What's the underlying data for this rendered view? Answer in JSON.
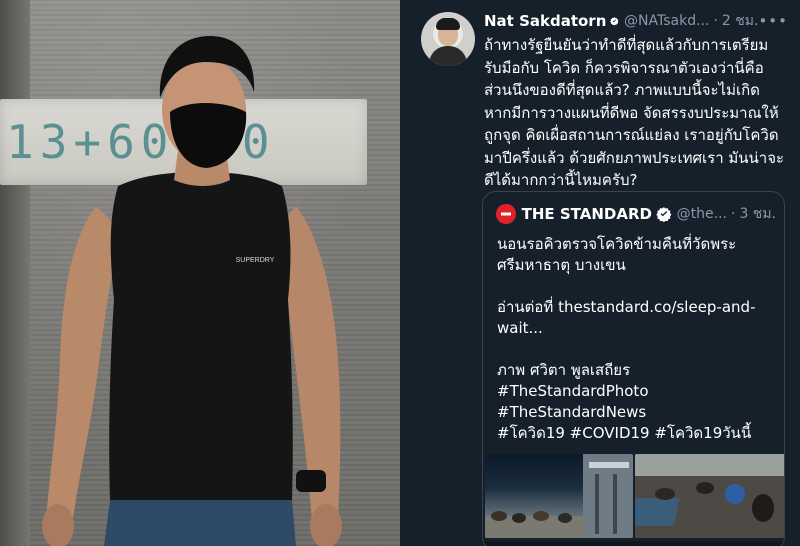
{
  "photo": {
    "sign_text": "13+60  00",
    "shirt_brand": "SUPERDRY"
  },
  "tweet": {
    "display_name": "Nat Sakdatorn",
    "handle": "@NATsakd...",
    "separator": "·",
    "time": "2 ชม.",
    "more_label": "•••",
    "body": "ถ้าทางรัฐยืนยันว่าทำดีที่สุดแล้วกับการเตรียม\nรับมือกับ โควิด ก็ควรพิจารณาตัวเองว่านี่คือ\nส่วนนึงของดีที่สุดแล้ว? ภาพแบบนี้จะไม่เกิด\nหากมีการวางแผนที่ดีพอ จัดสรรงบประมาณให้\nถูกจุด คิดเผื่อสถานการณ์แย่ลง เราอยู่กับโควิด\nมาปีครึ่งแล้ว ด้วยศักยภาพประเทศเรา มันน่าจะ\nดีได้มากกว่านี้ไหมครับ?",
    "quote": {
      "logo_text": "THE STANDARD",
      "display_name": "THE STANDARD",
      "handle": "@the...",
      "separator": "·",
      "time": "3 ชม.",
      "lines": [
        "นอนรอคิวตรวจโควิดข้ามคืนที่วัดพระ",
        "ศรีมหาธาตุ บางเขน",
        "อ่านต่อที่ thestandard.co/sleep-and-",
        "wait...",
        "ภาพ ศวิตา พูลเสถียร",
        "#TheStandardPhoto",
        "#TheStandardNews",
        "#โควิด19 #COVID19 #โควิด19วันนี้"
      ]
    }
  },
  "colors": {
    "background": "#15202b",
    "text": "#ffffff",
    "secondary_text": "#8899a6",
    "border": "#38444d",
    "verified": "#1da1f2",
    "logo": "#e0212a"
  },
  "icons": {
    "verified": "verified-badge-icon",
    "more": "more-options-icon"
  }
}
